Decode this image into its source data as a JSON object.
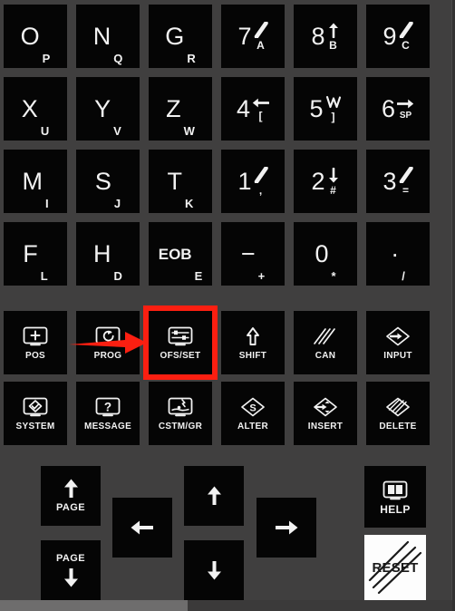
{
  "device": {
    "name": "FANUC MDI keypad",
    "background_color": "#403f3f",
    "key_color": "#050505",
    "key_text_color": "#f2f2f2",
    "highlight_color": "#fb1f11",
    "reset_key_color": "#fdfdfd"
  },
  "data_keys": [
    {
      "main": "O",
      "sub": "P",
      "name": "key-o-p"
    },
    {
      "main": "N",
      "sub": "Q",
      "name": "key-n-q"
    },
    {
      "main": "G",
      "sub": "R",
      "name": "key-g-r"
    },
    {
      "main": "7",
      "glyph": "slash-stroke",
      "sub": "A",
      "name": "key-7-a"
    },
    {
      "main": "8",
      "glyph": "arrow-up-bar",
      "sub": "B",
      "name": "key-8-b"
    },
    {
      "main": "9",
      "glyph": "slash-stroke",
      "sub": "C",
      "name": "key-9-c"
    },
    {
      "main": "X",
      "sub": "U",
      "name": "key-x-u"
    },
    {
      "main": "Y",
      "sub": "V",
      "name": "key-y-v"
    },
    {
      "main": "Z",
      "sub": "W",
      "name": "key-z-w"
    },
    {
      "main": "4",
      "glyph": "arrow-left-bar",
      "sub": "[",
      "name": "key-4-bracket-open"
    },
    {
      "main": "5",
      "glyph": "arrow-zigzag",
      "sub": "]",
      "name": "key-5-bracket-close"
    },
    {
      "main": "6",
      "glyph": "arrow-right-bar",
      "sub": "SP",
      "name": "key-6-sp"
    },
    {
      "main": "M",
      "sub": "I",
      "name": "key-m-i"
    },
    {
      "main": "S",
      "sub": "J",
      "name": "key-s-j"
    },
    {
      "main": "T",
      "sub": "K",
      "name": "key-t-k"
    },
    {
      "main": "1",
      "glyph": "slash-stroke",
      "sub": ",",
      "name": "key-1-comma"
    },
    {
      "main": "2",
      "glyph": "arrow-down-bar",
      "sub": "#",
      "name": "key-2-hash"
    },
    {
      "main": "3",
      "glyph": "slash-stroke",
      "sub": "=",
      "name": "key-3-equals"
    },
    {
      "main": "F",
      "sub": "L",
      "name": "key-f-l"
    },
    {
      "main": "H",
      "sub": "D",
      "name": "key-h-d"
    },
    {
      "main": "EOB",
      "sub": "E",
      "name": "key-eob-e",
      "small": true
    },
    {
      "main": "−",
      "sub": "+",
      "name": "key-minus-plus"
    },
    {
      "main": "0",
      "sub": "*",
      "name": "key-0-asterisk"
    },
    {
      "main": "·",
      "sub": "/",
      "name": "key-dot-slash"
    }
  ],
  "function_keys": [
    {
      "label": "POS",
      "icon": "screen-plus-icon",
      "name": "key-pos",
      "highlighted": false
    },
    {
      "label": "PROG",
      "icon": "screen-loop-icon",
      "name": "key-prog",
      "highlighted": false
    },
    {
      "label": "OFS/SET",
      "icon": "screen-offset-icon",
      "name": "key-ofs-set",
      "highlighted": true
    },
    {
      "label": "SHIFT",
      "icon": "arrow-up-outline-icon",
      "name": "key-shift",
      "highlighted": false
    },
    {
      "label": "CAN",
      "icon": "triple-slash-icon",
      "name": "key-can",
      "highlighted": false
    },
    {
      "label": "INPUT",
      "icon": "diamond-arrow-in-icon",
      "name": "key-input",
      "highlighted": false
    },
    {
      "label": "SYSTEM",
      "icon": "screen-diamond-icon",
      "name": "key-system",
      "highlighted": false
    },
    {
      "label": "MESSAGE",
      "icon": "screen-question-icon",
      "name": "key-message",
      "highlighted": false
    },
    {
      "label": "CSTM/GR",
      "icon": "screen-graph-icon",
      "name": "key-cstm-gr",
      "highlighted": false
    },
    {
      "label": "ALTER",
      "icon": "diamond-alter-icon",
      "name": "key-alter",
      "highlighted": false
    },
    {
      "label": "INSERT",
      "icon": "diamond-insert-icon",
      "name": "key-insert",
      "highlighted": false
    },
    {
      "label": "DELETE",
      "icon": "diamond-delete-icon",
      "name": "key-delete",
      "highlighted": false
    }
  ],
  "nav_keys": {
    "page_up": {
      "label": "PAGE",
      "icon": "arrow-up-icon",
      "name": "key-page-up"
    },
    "page_down": {
      "label": "PAGE",
      "icon": "arrow-down-icon",
      "name": "key-page-down"
    },
    "cursor_up": {
      "icon": "arrow-up-icon",
      "name": "key-cursor-up"
    },
    "cursor_down": {
      "icon": "arrow-down-icon",
      "name": "key-cursor-down"
    },
    "cursor_left": {
      "icon": "arrow-left-icon",
      "name": "key-cursor-left"
    },
    "cursor_right": {
      "icon": "arrow-right-icon",
      "name": "key-cursor-right"
    },
    "help": {
      "label": "HELP",
      "icon": "book-screen-icon",
      "name": "key-help"
    },
    "reset": {
      "label": "RESET",
      "icon": "strike-lines-icon",
      "name": "key-reset"
    }
  },
  "annotation": {
    "type": "arrow",
    "color": "#fb1f11",
    "points_to": "OFS/SET",
    "highlight_box_target": "OFS/SET"
  }
}
